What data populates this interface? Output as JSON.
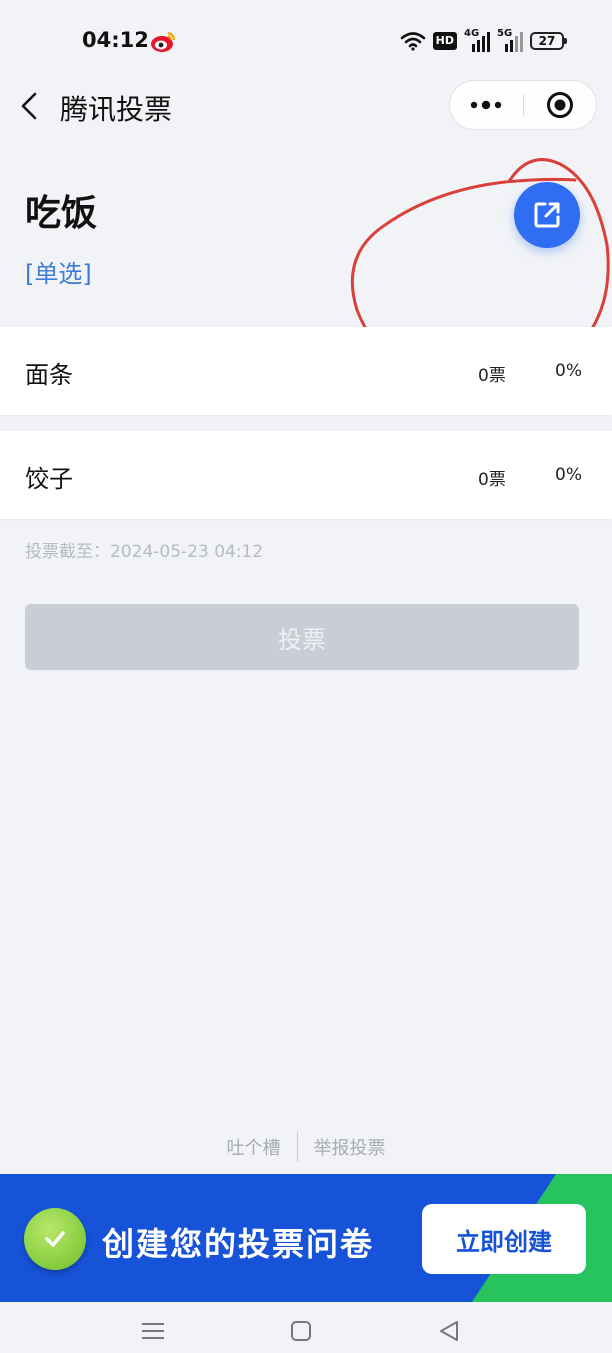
{
  "status_bar": {
    "time": "04:12",
    "hd_label": "HD",
    "net1_label": "4G",
    "net2_label": "5G",
    "battery": "27",
    "icons": [
      "weibo-icon",
      "wifi-icon",
      "signal-icon",
      "battery-icon"
    ]
  },
  "nav": {
    "title": "腾讯投票",
    "icons": [
      "back-arrow-icon",
      "more-dots-icon",
      "target-icon"
    ]
  },
  "vote": {
    "title": "吃饭",
    "type": "[单选]",
    "options": [
      {
        "label": "面条",
        "votes": "0票",
        "percent": "0%"
      },
      {
        "label": "饺子",
        "votes": "0票",
        "percent": "0%"
      }
    ],
    "deadline_label": "投票截至：",
    "deadline_value": "2024-05-23 04:12",
    "vote_button": "投票"
  },
  "footer": {
    "feedback": "吐个槽",
    "report": "举报投票"
  },
  "banner": {
    "text": "创建您的投票问卷",
    "button": "立即创建"
  },
  "colors": {
    "accent": "#2f6df3",
    "type_label": "#3e7bd6",
    "banner_blue": "#1753d8",
    "banner_green": "#26c35e",
    "annotation_red": "#d9403a",
    "disabled_button": "#c9ced6"
  }
}
